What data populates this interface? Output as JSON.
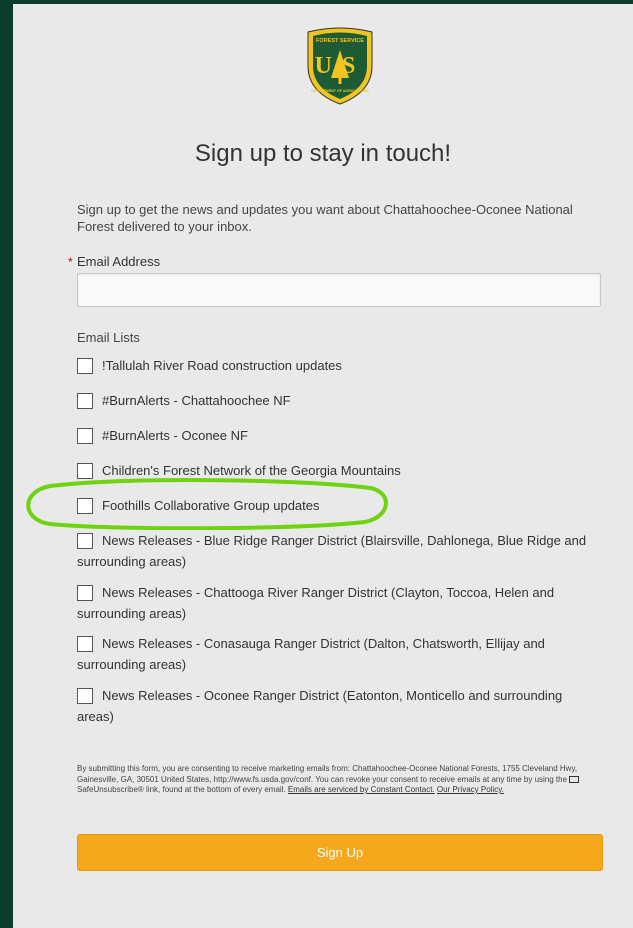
{
  "logo": {
    "text_top": "FOREST SERVICE",
    "text_mid": "US",
    "text_bottom": "DEPARTMENT OF AGRICULTURE",
    "icon": "forest-service-shield"
  },
  "title": "Sign up to stay in touch!",
  "intro": "Sign up to get the news and updates you want about Chattahoochee-Oconee National Forest delivered to your inbox.",
  "email": {
    "required_marker": "*",
    "label": "Email Address",
    "value": "",
    "placeholder": ""
  },
  "lists": {
    "label": "Email Lists",
    "items": [
      {
        "label": "!Tallulah River Road construction updates",
        "checked": false
      },
      {
        "label": "#BurnAlerts - Chattahoochee NF",
        "checked": false
      },
      {
        "label": "#BurnAlerts - Oconee NF",
        "checked": false
      },
      {
        "label": "Children's Forest Network of the Georgia Mountains",
        "checked": false
      },
      {
        "label": "Foothills Collaborative Group updates",
        "checked": false
      },
      {
        "label": "News Releases - Blue Ridge Ranger District (Blairsville, Dahlonega, Blue Ridge and surrounding areas)",
        "checked": false
      },
      {
        "label": "News Releases - Chattooga River Ranger District (Clayton, Toccoa, Helen and surrounding areas)",
        "checked": false
      },
      {
        "label": "News Releases - Conasauga Ranger District (Dalton, Chatsworth, Ellijay and surrounding areas)",
        "checked": false
      },
      {
        "label": "News Releases - Oconee Ranger District (Eatonton, Monticello and surrounding areas)",
        "checked": false
      }
    ]
  },
  "legal": {
    "text_before_icon": "By submitting this form, you are consenting to receive marketing emails from: Chattahoochee-Oconee National Forests, 1755 Cleveland Hwy, Gainesville, GA, 30501 United States, http://www.fs.usda.gov/conf. You can revoke your consent to receive emails at any time by using the",
    "text_after_icon": "SafeUnsubscribe® link, found at the bottom of every email.",
    "link_constant_contact": "Emails are serviced by Constant Contact.",
    "link_privacy": "Our Privacy Policy."
  },
  "submit_label": "Sign Up",
  "colors": {
    "brand_green": "#0b3d2a",
    "button": "#f6a81c",
    "highlight": "#6fd40f",
    "required": "#cc0000"
  }
}
